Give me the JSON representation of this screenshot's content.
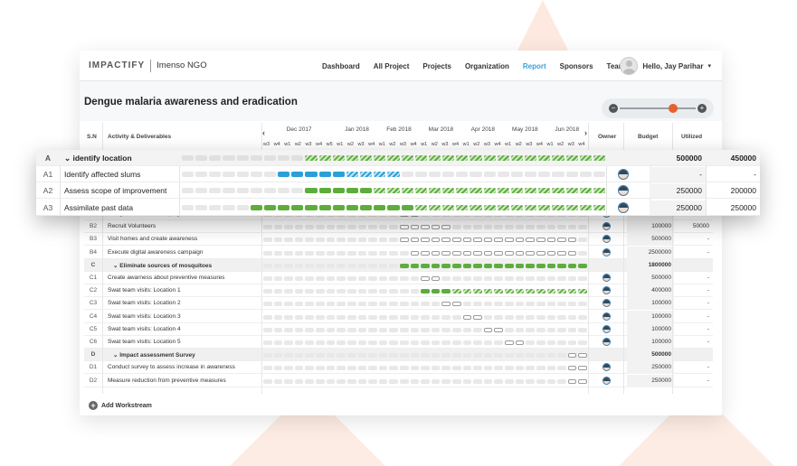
{
  "brand": {
    "logo": "IMPACTIFY",
    "org": "Imenso NGO"
  },
  "nav": [
    "Dashboard",
    "All Project",
    "Projects",
    "Organization",
    "Report",
    "Sponsors",
    "Team"
  ],
  "nav_active": "Report",
  "user": {
    "greeting": "Hello, Jay Parihar"
  },
  "page": {
    "title": "Dengue malaria awareness and eradication"
  },
  "zoom": {
    "level": 0.7
  },
  "headers": {
    "sn": "S.N",
    "activity": "Activity & Deliverables",
    "owner": "Owner",
    "budget": "Budget",
    "utilized": "Utilized"
  },
  "months": [
    "Dec 2017",
    "Jan 2018",
    "Feb 2018",
    "Mar 2018",
    "Apr 2018",
    "May 2018",
    "Jun 2018"
  ],
  "weeks": [
    "w3",
    "w4",
    "w1",
    "w2",
    "w3",
    "w4",
    "w5",
    "w1",
    "w2",
    "w3",
    "w4",
    "w1",
    "w2",
    "w3",
    "w4",
    "w1",
    "w2",
    "w3",
    "w4",
    "w1",
    "w2",
    "w3",
    "w4",
    "w1",
    "w2",
    "w3",
    "w4",
    "w1",
    "w2",
    "w3",
    "w4"
  ],
  "popup_rows": [
    {
      "sn": "A",
      "activity": "identify location",
      "budget": "500000",
      "utilized": "450000",
      "section": true,
      "bars": "hhhhhhhhhggggggggggggggggggggggg"
    },
    {
      "sn": "A1",
      "activity": "Identify affected slums",
      "budget": "-",
      "utilized": "-",
      "section": false,
      "bars": "ooooooobbbbbddddoooooooooooooooo"
    },
    {
      "sn": "A2",
      "activity": "Assess scope of improvement",
      "budget": "250000",
      "utilized": "200000",
      "section": false,
      "bars": "oooooooooGGGGGggggggggggggggggggg"
    },
    {
      "sn": "A3",
      "activity": "Assimilate past data",
      "budget": "250000",
      "utilized": "250000",
      "section": false,
      "bars": "oooooGGGGGGGGGGGGggggggggggggggg"
    }
  ],
  "rows": [
    {
      "sn": "B1",
      "activity": "Design awareness campaign",
      "budget": "100000",
      "utilized": "100000",
      "section": false
    },
    {
      "sn": "B2",
      "activity": "Recruit Volunteers",
      "budget": "100000",
      "utilized": "50000",
      "section": false
    },
    {
      "sn": "B3",
      "activity": "Visit homes and create awareness",
      "budget": "500000",
      "utilized": "-",
      "section": false
    },
    {
      "sn": "B4",
      "activity": "Execute digital awareness campaign",
      "budget": "2500000",
      "utilized": "-",
      "section": false
    },
    {
      "sn": "C",
      "activity": "Eliminate sources of mosquitoes",
      "budget": "1800000",
      "utilized": "",
      "section": true
    },
    {
      "sn": "C1",
      "activity": "Create awarness about preventive measures",
      "budget": "500000",
      "utilized": "-",
      "section": false
    },
    {
      "sn": "C2",
      "activity": "Swat team visits: Location 1",
      "budget": "400000",
      "utilized": "-",
      "section": false
    },
    {
      "sn": "C3",
      "activity": "Swat team visits: Location 2",
      "budget": "100000",
      "utilized": "-",
      "section": false
    },
    {
      "sn": "C4",
      "activity": "Swat team visits: Location 3",
      "budget": "100000",
      "utilized": "-",
      "section": false
    },
    {
      "sn": "C5",
      "activity": "Swat team visits: Location 4",
      "budget": "100000",
      "utilized": "-",
      "section": false
    },
    {
      "sn": "C6",
      "activity": "Swat team visits: Location 5",
      "budget": "100000",
      "utilized": "-",
      "section": false
    },
    {
      "sn": "D",
      "activity": "Impact assessment Survey",
      "budget": "500000",
      "utilized": "",
      "section": true
    },
    {
      "sn": "D1",
      "activity": "Conduct survey to assess increase in awareness",
      "budget": "250000",
      "utilized": "-",
      "section": false
    },
    {
      "sn": "D2",
      "activity": "Measure reduction from preventive measures",
      "budget": "250000",
      "utilized": "-",
      "section": false
    }
  ],
  "add_workstream": "Add Workstream",
  "colors": {
    "green": "#5cad3c",
    "blue": "#2a9fd8",
    "grey": "#e4e4e4",
    "accent": "#e8602c",
    "link": "#3aa0dc"
  }
}
